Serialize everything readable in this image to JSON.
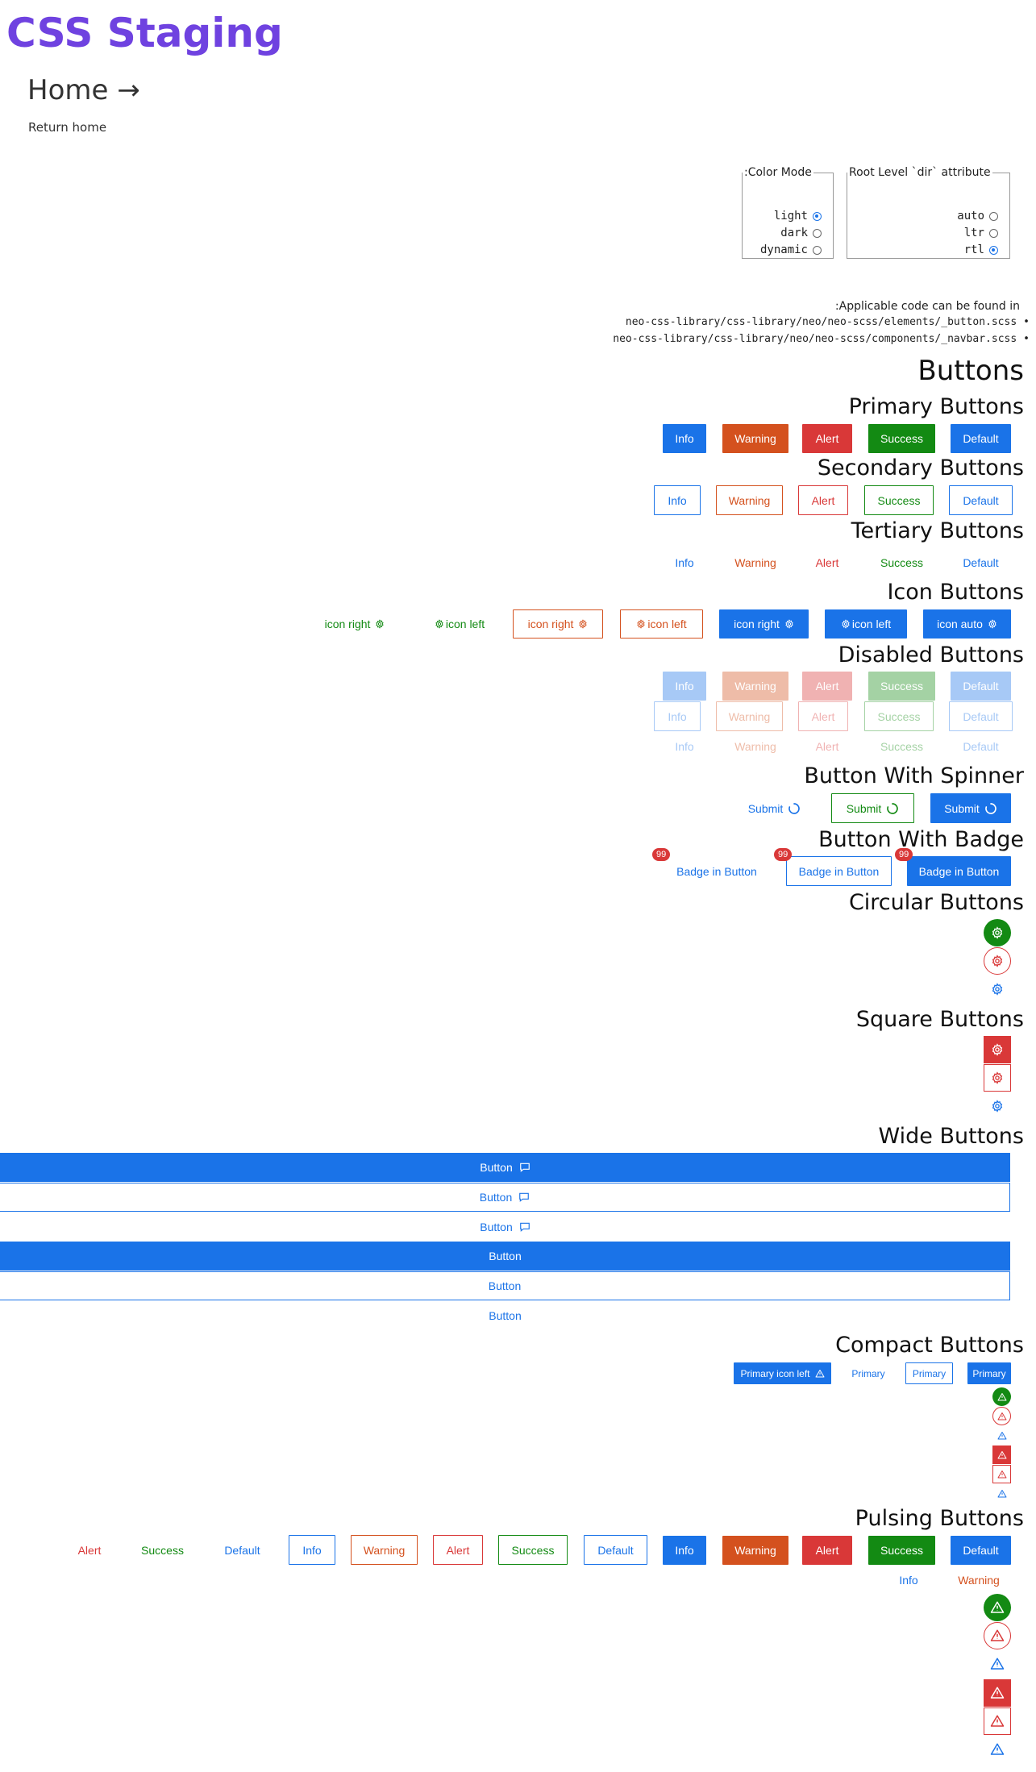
{
  "header": {
    "title": "CSS Staging",
    "home_link": "Home →",
    "return_link": "Return home"
  },
  "color_mode": {
    "legend": ":Color Mode",
    "options": [
      "light",
      "dark",
      "dynamic"
    ],
    "selected": "light"
  },
  "dir_attr": {
    "legend": "Root Level `dir` attribute",
    "options": [
      "auto",
      "ltr",
      "rtl"
    ],
    "selected": "rtl"
  },
  "code": {
    "intro": ":Applicable code can be found in",
    "files": [
      "neo-css-library/css-library/neo/neo-scss/elements/_button.scss",
      "neo-css-library/css-library/neo/neo-scss/components/_navbar.scss"
    ]
  },
  "headings": {
    "buttons": "Buttons",
    "primary": "Primary Buttons",
    "secondary": "Secondary Buttons",
    "tertiary": "Tertiary Buttons",
    "icon": "Icon Buttons",
    "disabled": "Disabled Buttons",
    "spinner": "Button With Spinner",
    "badge": "Button With Badge",
    "circular": "Circular Buttons",
    "square": "Square Buttons",
    "wide": "Wide Buttons",
    "compact": "Compact Buttons",
    "pulsing": "Pulsing Buttons"
  },
  "labels": {
    "info": "Info",
    "warning": "Warning",
    "alert": "Alert",
    "success": "Success",
    "default": "Default"
  },
  "icon_buttons": {
    "right": "icon right",
    "left": "icon left",
    "auto": "icon auto"
  },
  "spinner": {
    "label": "Submit"
  },
  "badge": {
    "label": "Badge in Button",
    "count": "99"
  },
  "wide": {
    "label": "Button"
  },
  "compact": {
    "primary_icon_left": "Primary icon left",
    "primary": "Primary"
  },
  "colors": {
    "info": "#1a73e8",
    "warning": "#d4511e",
    "alert": "#d93838",
    "success": "#138a13",
    "brand": "#6f42e0"
  },
  "icons": {
    "gear": "gear-icon",
    "chat": "chat-icon",
    "warning": "warning-triangle-icon",
    "spinner": "spinner-icon"
  }
}
